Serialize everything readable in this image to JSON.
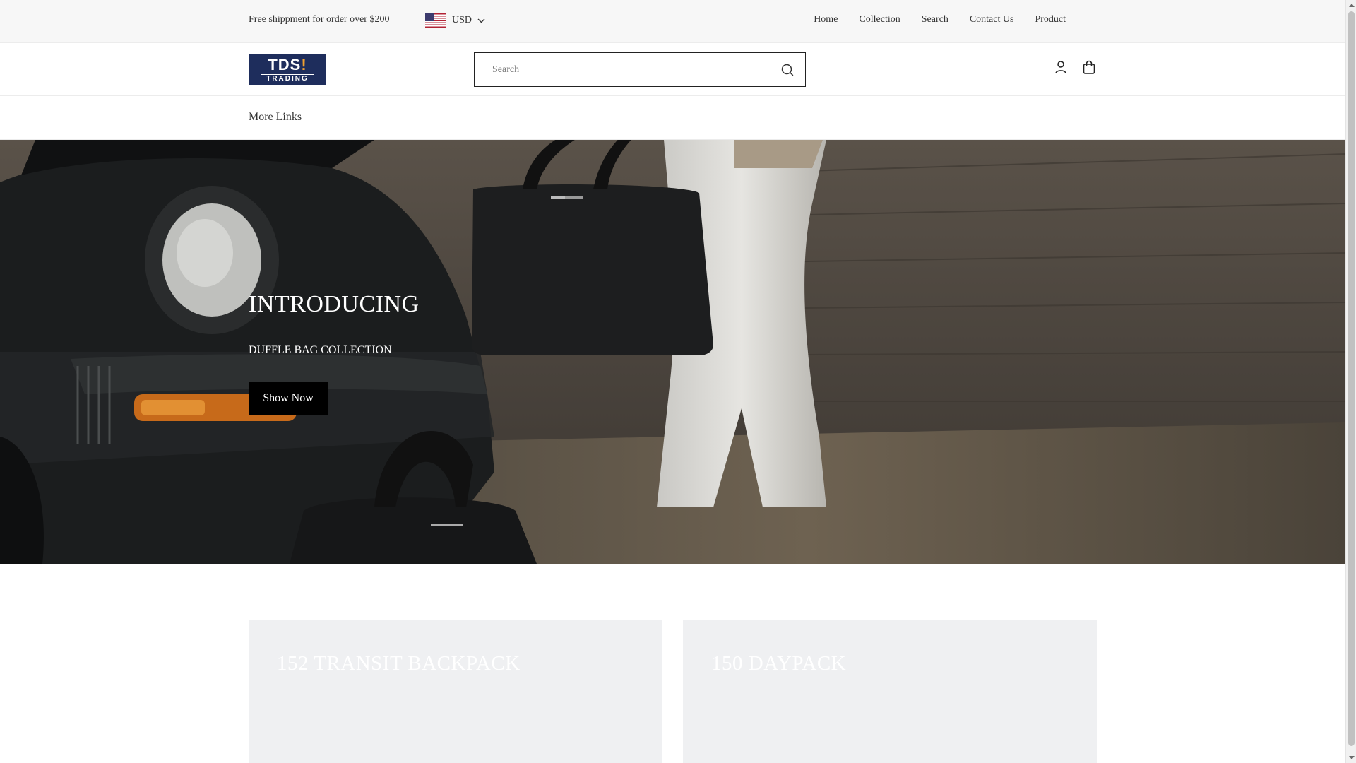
{
  "announcement": {
    "shipping_text": "Free shippment for order over $200",
    "currency": "USD",
    "currency_flag_icon": "us-flag-icon"
  },
  "top_nav": {
    "items": [
      {
        "label": "Home"
      },
      {
        "label": "Collection"
      },
      {
        "label": "Search"
      },
      {
        "label": "Contact Us"
      },
      {
        "label": "Product"
      }
    ]
  },
  "header": {
    "logo_line1_main": "TDS",
    "logo_line1_accent": "!",
    "logo_line2": "TRADING",
    "search_placeholder": "Search",
    "search_icon": "search-icon",
    "account_icon": "user-icon",
    "cart_icon": "shopping-bag-icon"
  },
  "menu": {
    "more_links_label": "More Links"
  },
  "hero": {
    "title": "INTRODUCING",
    "subtitle": "DUFFLE BAG COLLECTION",
    "button_label": "Show Now"
  },
  "collections": [
    {
      "title": "152 TRANSIT BACKPACK"
    },
    {
      "title": "150 DAYPACK"
    }
  ],
  "colors": {
    "topbar_bg": "#f7f7f7",
    "logo_bg": "#1e2d5c",
    "logo_accent": "#f0a030",
    "button_bg": "#000000",
    "card_bg": "#eff0f2"
  }
}
